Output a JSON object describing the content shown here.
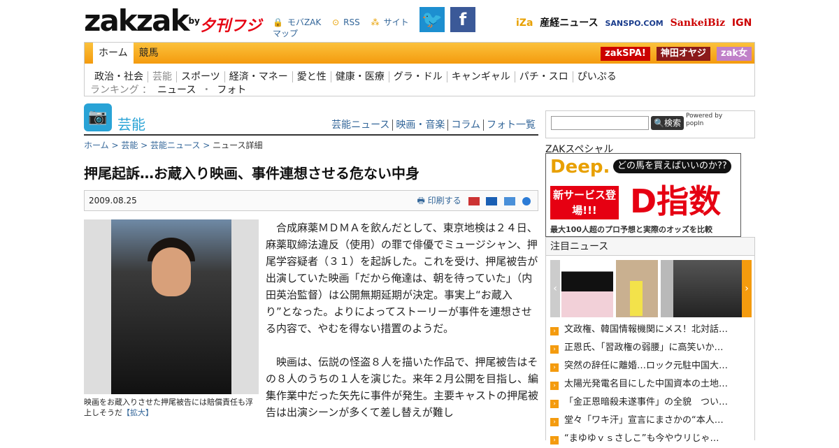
{
  "header": {
    "logo": "zakzak",
    "logo_by": "by",
    "logo_partner": "夕刊フジ",
    "links": [
      "モバZAK",
      "RSS",
      "サイトマップ"
    ],
    "sns": [
      "twitter",
      "facebook"
    ],
    "partners": [
      "iZa",
      "産経ニュース",
      "SANSPO.COM",
      "SankeiBiz",
      "IGN"
    ]
  },
  "nav": {
    "tabs": [
      "ホーム",
      "競馬"
    ],
    "banners": [
      "zakSPA!",
      "神田オヤジ",
      "zak女"
    ],
    "sub": [
      "政治・社会",
      "芸能",
      "スポーツ",
      "経済・マネー",
      "愛と性",
      "健康・医療",
      "グラ・ドル",
      "キャンギャル",
      "パチ・スロ",
      "ぴいぷる"
    ],
    "rank_label": "ランキング ：",
    "rank_items": [
      "ニュース",
      "・",
      "フォト"
    ]
  },
  "section": {
    "title": "芸能",
    "links": [
      "芸能ニュース",
      "映画・音楽",
      "コラム",
      "フォト一覧"
    ]
  },
  "breadcrumb": [
    "ホーム",
    "芸能",
    "芸能ニュース",
    "ニュース詳細"
  ],
  "article": {
    "headline": "押尾起訴…お蔵入り映画、事件連想させる危ない中身",
    "date": "2009.08.25",
    "print": "印刷する",
    "caption": "映画をお蔵入りさせた押尾被告には賠償責任も浮上しそうだ",
    "caption_link": "【拡大】",
    "paragraphs": [
      "合成麻薬ＭＤＭＡを飲んだとして、東京地検は２４日、麻薬取締法違反（使用）の罪で俳優でミュージシャン、押尾学容疑者（３１）を起訴した。これを受け、押尾被告が出演していた映画「だから俺達は、朝を待っていた」（内田英治監督）は公開無期延期が決定。事実上“お蔵入り”となった。よりによってストーリーが事件を連想させる内容で、やむを得ない措置のようだ。",
      "映画は、伝説の怪盗８人を描いた作品で、押尾被告はその８人のうちの１人を演じた。来年２月公開を目指し、編集作業中だった矢先に事件が発生。主要キャストの押尾被告は出演シーンが多くて差し替えが難し"
    ]
  },
  "sidebar": {
    "search_btn": "検索",
    "powered": "Powered by popIn",
    "zak_special": "ZAKスペシャル",
    "ad": {
      "brand": "Deep.",
      "q": "どの馬を買えばいいのか??",
      "badge": "新サービス登場!!!",
      "big": "D指数",
      "foot": "最大100人超のプロ予想と実際のオッズを比較"
    },
    "focus_title": "注目ニュース",
    "news": [
      "文政権、韓国情報機関にメス！北対話…",
      "正恩氏、「習政権の弱腰」に高笑いか…",
      "突然の辞任に離婚…ロック元駐中国大…",
      "太陽光発電名目にした中国資本の土地…",
      "「金正恩暗殺未遂事件」の全貌　つい…",
      "堂々「ワキ汗」宣言にまさかの“本人…",
      "“まゆゆｖｓさしこ”も今やウリじゃ…"
    ]
  }
}
